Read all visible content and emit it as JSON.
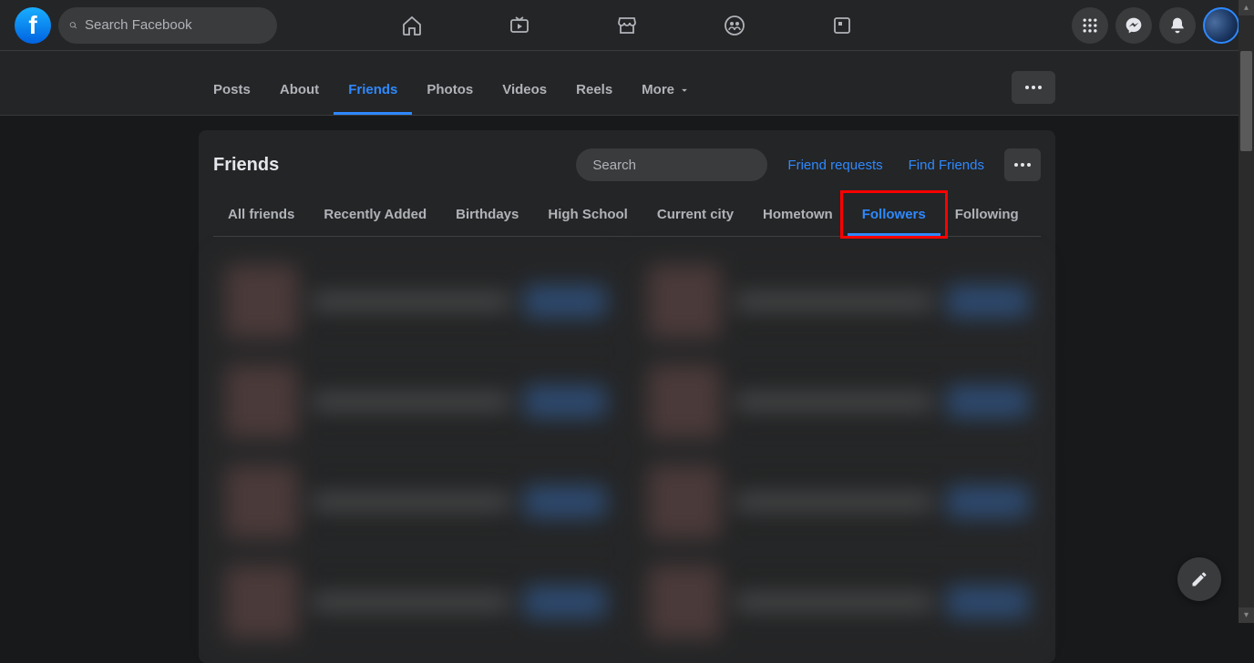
{
  "header": {
    "search_placeholder": "Search Facebook"
  },
  "profile_tabs": [
    {
      "label": "Posts",
      "active": false
    },
    {
      "label": "About",
      "active": false
    },
    {
      "label": "Friends",
      "active": true
    },
    {
      "label": "Photos",
      "active": false
    },
    {
      "label": "Videos",
      "active": false
    },
    {
      "label": "Reels",
      "active": false
    },
    {
      "label": "More",
      "active": false,
      "has_caret": true
    }
  ],
  "card": {
    "title": "Friends",
    "search_placeholder": "Search",
    "friend_requests_label": "Friend requests",
    "find_friends_label": "Find Friends"
  },
  "filter_tabs": [
    {
      "label": "All friends",
      "active": false
    },
    {
      "label": "Recently Added",
      "active": false
    },
    {
      "label": "Birthdays",
      "active": false
    },
    {
      "label": "High School",
      "active": false
    },
    {
      "label": "Current city",
      "active": false
    },
    {
      "label": "Hometown",
      "active": false
    },
    {
      "label": "Followers",
      "active": true,
      "highlighted": true
    },
    {
      "label": "Following",
      "active": false
    }
  ],
  "colors": {
    "accent": "#2e89ff",
    "bg": "#18191a",
    "surface": "#242526",
    "highlight": "#ff0000"
  }
}
